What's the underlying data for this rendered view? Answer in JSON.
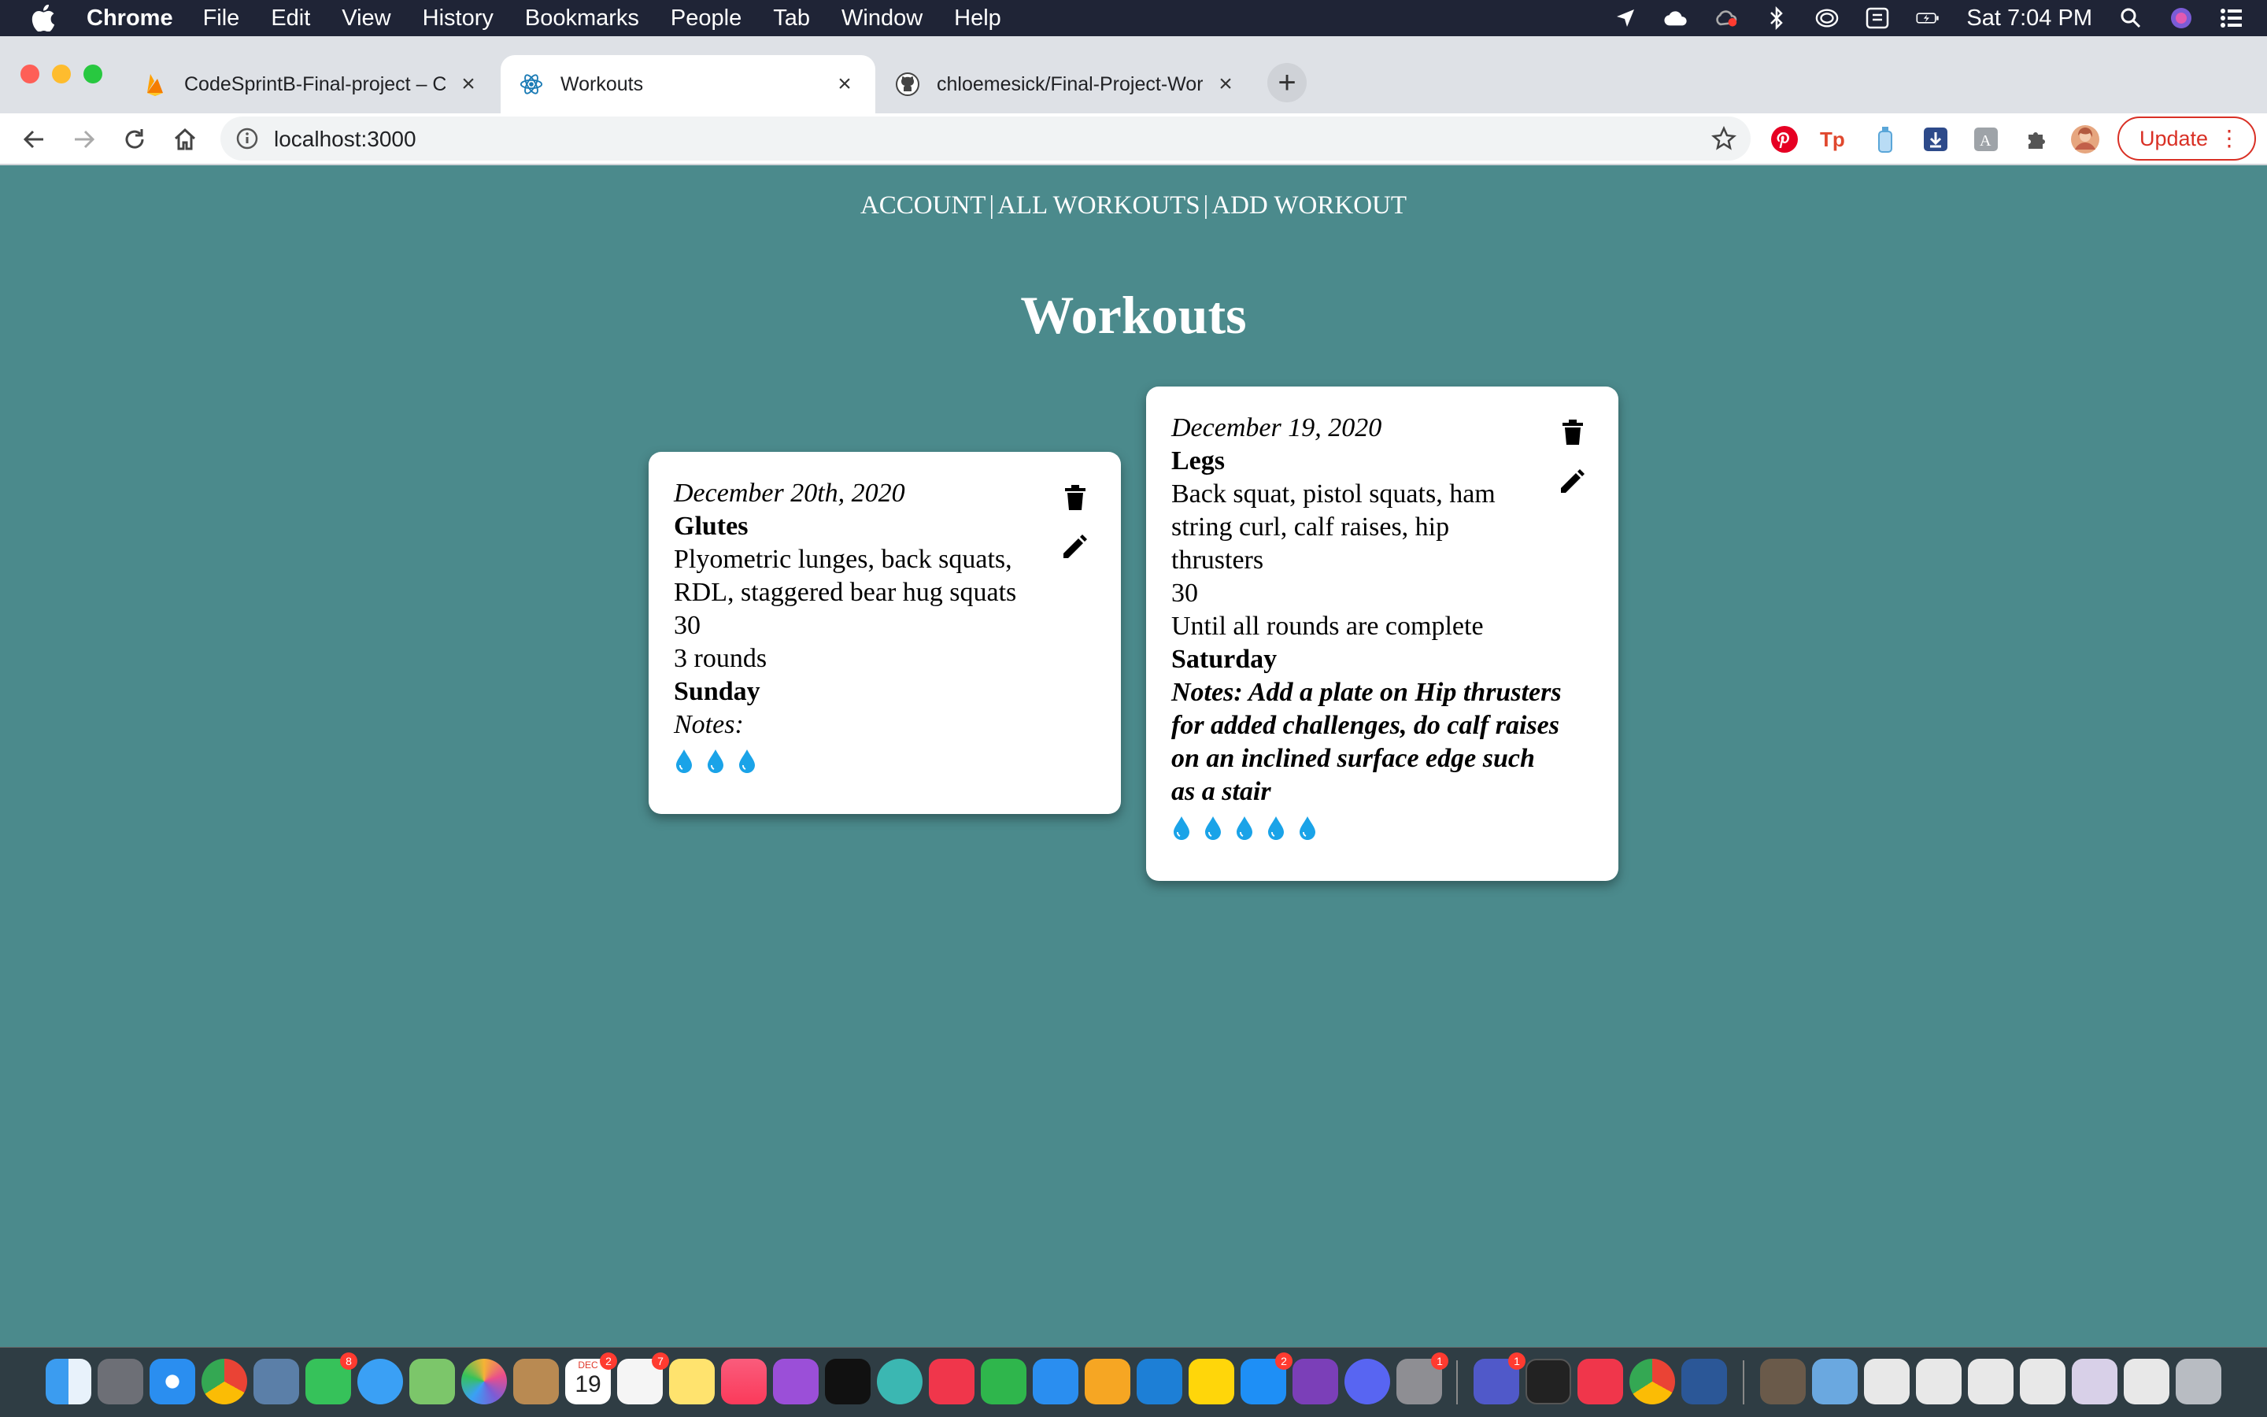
{
  "menubar": {
    "app": "Chrome",
    "items": [
      "File",
      "Edit",
      "View",
      "History",
      "Bookmarks",
      "People",
      "Tab",
      "Window",
      "Help"
    ],
    "clock": "Sat 7:04 PM"
  },
  "tabs": [
    {
      "title": "CodeSprintB-Final-project – Cl",
      "active": false
    },
    {
      "title": "Workouts",
      "active": true
    },
    {
      "title": "chloemesick/Final-Project-Wor",
      "active": false
    }
  ],
  "toolbar": {
    "url": "localhost:3000",
    "update_label": "Update"
  },
  "page": {
    "nav": {
      "account": "ACCOUNT",
      "all_workouts": "ALL WORKOUTS",
      "add_workout": "ADD WORKOUT",
      "separator": "|"
    },
    "heading": "Workouts",
    "workouts": [
      {
        "date": "December 20th, 2020",
        "name": "Glutes",
        "exercises": "Plyometric lunges, back squats, RDL, staggered bear hug squats",
        "duration": "30",
        "rounds": "3 rounds",
        "day": "Sunday",
        "notes": "Notes:",
        "intensity": 3
      },
      {
        "date": "December 19, 2020",
        "name": "Legs",
        "exercises": "Back squat, pistol squats, ham string curl, calf raises, hip thrusters",
        "duration": "30",
        "rounds": "Until all rounds are complete",
        "day": "Saturday",
        "notes": "Notes: Add a plate on Hip thrusters for added challenges, do calf raises on an inclined surface edge such as a stair",
        "intensity": 5
      }
    ]
  },
  "dock": {
    "calendar_month": "DEC",
    "calendar_day": "19",
    "badges": {
      "facetime": "8",
      "calendar": "2",
      "reminders": "7",
      "appstore": "2",
      "settings": "1",
      "teams": "1"
    }
  },
  "colors": {
    "page_bg": "#4b8a8c",
    "card_bg": "#ffffff",
    "drop": "#1aa3e8",
    "update_red": "#d93025"
  }
}
